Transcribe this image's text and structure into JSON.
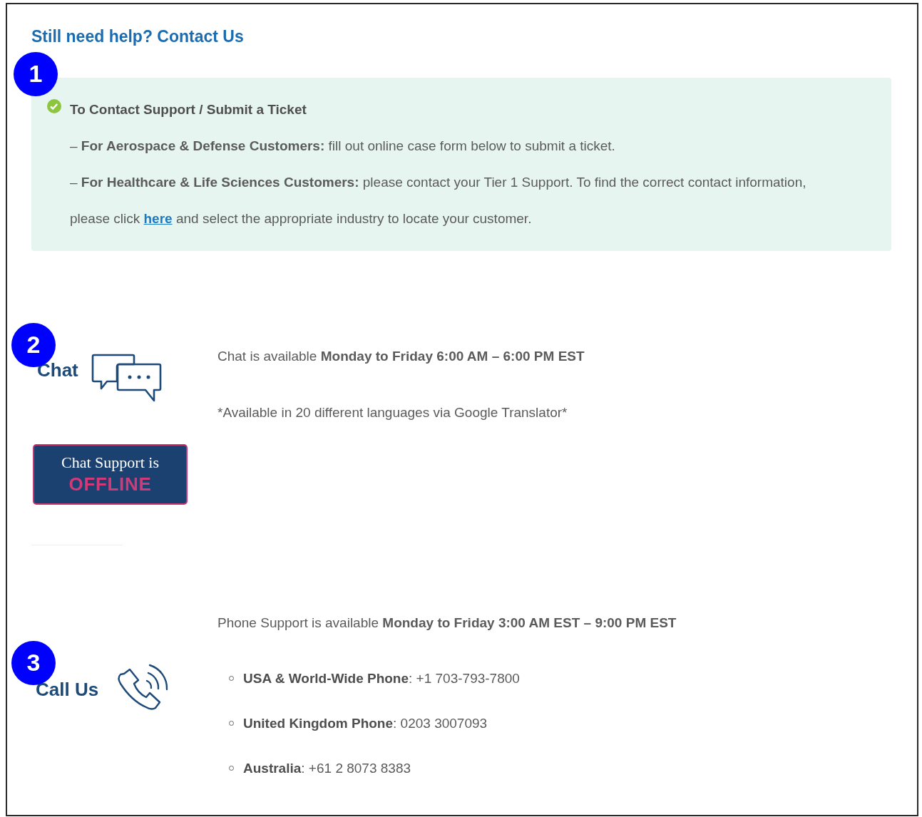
{
  "heading": "Still need help? Contact Us",
  "notice": {
    "badge": "1",
    "title": "To Contact Support / Submit a Ticket",
    "lines": [
      "– **For Aerospace & Defense Customers:** fill out online case form below to submit a ticket.",
      "– **For Healthcare & Life Sciences Customers:** please contact your Tier 1 Support. To find the correct contact information,"
    ],
    "link_line": {
      "before": "please click ",
      "link": "here",
      "after": " and select the appropriate industry to locate your customer."
    }
  },
  "chat": {
    "badge": "2",
    "label": "Chat",
    "hours": "Chat is available **Monday to Friday 6:00 AM – 6:00 PM EST**",
    "note": "*Available in 20 different languages via Google Translator*",
    "status_button": {
      "line_1": "Chat Support is",
      "status": "OFFLINE",
      "online": false
    }
  },
  "phone": {
    "badge": "3",
    "label": "Call Us",
    "hours": "Phone Support is available **Monday to Friday 3:00 AM EST – 9:00 PM EST**",
    "numbers": [
      {
        "label": "USA & World-Wide Phone",
        "number": ": +1 703-793-7800"
      },
      {
        "label": "United Kingdom Phone",
        "number": ": 0203 3007093"
      },
      {
        "label": "Australia",
        "number": ": +61 2 8073 8383"
      }
    ]
  }
}
